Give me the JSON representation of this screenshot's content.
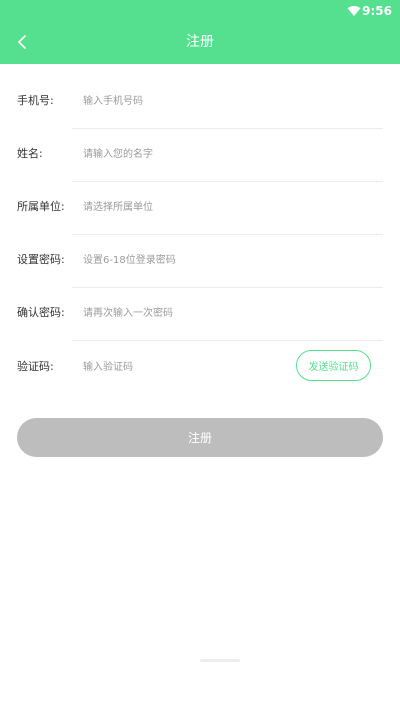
{
  "status_bar": {
    "time": "9:56",
    "wifi_icon": "wifi-icon"
  },
  "header": {
    "title": "注册",
    "back_icon": "chevron-left-icon",
    "background": "#55e08f"
  },
  "form": {
    "fields": [
      {
        "label": "手机号:",
        "placeholder": "输入手机号码"
      },
      {
        "label": "姓名:",
        "placeholder": "请输入您的名字"
      },
      {
        "label": "所属单位:",
        "placeholder": "请选择所属单位"
      },
      {
        "label": "设置密码:",
        "placeholder": "设置6-18位登录密码"
      },
      {
        "label": "确认密码:",
        "placeholder": "请再次输入一次密码"
      },
      {
        "label": "验证码:",
        "placeholder": "输入验证码",
        "button_label": "发送验证码"
      }
    ]
  },
  "submit": {
    "label": "注册",
    "background": "#bdbdbd"
  }
}
